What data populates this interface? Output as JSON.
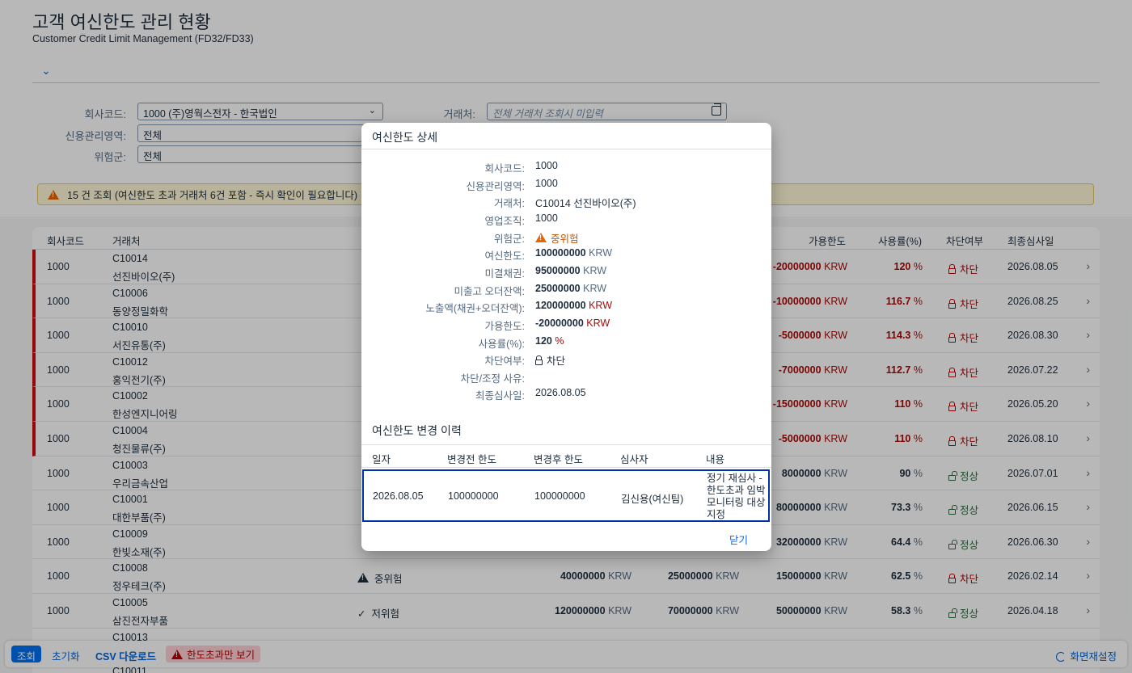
{
  "page": {
    "title": "고객 여신한도 관리 현황",
    "subtitle": "Customer Credit Limit Management (FD32/FD33)"
  },
  "filters": {
    "company_label": "회사코드:",
    "company_value": "1000 (주)영웍스전자 - 한국법인",
    "credit_area_label": "신용관리영역:",
    "credit_area_value": "전체",
    "risk_label": "위험군:",
    "risk_value": "전체",
    "customer_label": "거래처:",
    "customer_placeholder": "전체 거래처 조회시 미입력"
  },
  "message": "15 건 조회 (여신한도 초과 거래처 6건 포함 - 즉시 확인이 필요합니다)",
  "table": {
    "headers": {
      "company": "회사코드",
      "customer": "거래처",
      "available": "가용한도",
      "rate": "사용률(%)",
      "blocked": "차단여부",
      "last_review": "최종심사일"
    },
    "unit": "KRW",
    "pct": "%",
    "rows": [
      {
        "company": "1000",
        "id": "C10014",
        "name": "선진바이오(주)",
        "available": "-20000000",
        "rate": "120",
        "blocked": "차단",
        "date": "2026.08.05"
      },
      {
        "company": "1000",
        "id": "C10006",
        "name": "동양정밀화학",
        "available": "-10000000",
        "rate": "116.7",
        "blocked": "차단",
        "date": "2026.08.25"
      },
      {
        "company": "1000",
        "id": "C10010",
        "name": "서진유통(주)",
        "available": "-5000000",
        "rate": "114.3",
        "blocked": "차단",
        "date": "2026.08.30"
      },
      {
        "company": "1000",
        "id": "C10012",
        "name": "홍익전기(주)",
        "available": "-7000000",
        "rate": "112.7",
        "blocked": "차단",
        "date": "2026.07.22"
      },
      {
        "company": "1000",
        "id": "C10002",
        "name": "한성엔지니어링",
        "available": "-15000000",
        "rate": "110",
        "blocked": "차단",
        "date": "2026.05.20"
      },
      {
        "company": "1000",
        "id": "C10004",
        "name": "청진물류(주)",
        "available": "-5000000",
        "rate": "110",
        "blocked": "차단",
        "date": "2026.08.10"
      },
      {
        "company": "1000",
        "id": "C10003",
        "name": "우리금속산업",
        "available": "8000000",
        "rate": "90",
        "blocked": "정상",
        "date": "2026.07.01"
      },
      {
        "company": "1000",
        "id": "C10001",
        "name": "대한부품(주)",
        "available": "80000000",
        "rate": "73.3",
        "blocked": "정상",
        "date": "2026.06.15"
      },
      {
        "company": "1000",
        "id": "C10009",
        "name": "한빛소재(주)",
        "available": "32000000",
        "rate": "64.4",
        "blocked": "정상",
        "date": "2026.06.30"
      },
      {
        "company": "1000",
        "id": "C10008",
        "name": "정우테크(주)",
        "risk": "중위험",
        "limit": "40000000",
        "receivable": "25000000",
        "available": "15000000",
        "rate": "62.5",
        "blocked": "차단",
        "date": "2026.02.14"
      },
      {
        "company": "1000",
        "id": "C10005",
        "name": "삼진전자부품",
        "risk": "저위험",
        "limit": "120000000",
        "receivable": "70000000",
        "available": "50000000",
        "rate": "58.3",
        "blocked": "정상",
        "date": "2026.04.18"
      },
      {
        "company": "",
        "id": "C10013",
        "name": "",
        "available": "",
        "rate": "",
        "blocked": "",
        "date": ""
      },
      {
        "company": "",
        "id": "C10011",
        "name": "",
        "available": "",
        "rate": "",
        "blocked": "",
        "date": ""
      }
    ]
  },
  "footer": {
    "search": "조회",
    "reset": "초기화",
    "csv": "CSV 다운로드",
    "over_only": "한도초과만 보기",
    "layout": "화면재설정"
  },
  "dialog": {
    "title": "여신한도 상세",
    "fields": [
      {
        "label": "회사코드:",
        "value": "1000"
      },
      {
        "label": "신용관리영역:",
        "value": "1000"
      },
      {
        "label": "거래처:",
        "value": "C10014 선진바이오(주)"
      },
      {
        "label": "영업조직:",
        "value": "1000"
      },
      {
        "label": "위험군:",
        "value": "중위험"
      },
      {
        "label": "여신한도:",
        "value": "100000000"
      },
      {
        "label": "미결채권:",
        "value": "95000000"
      },
      {
        "label": "미출고 오더잔액:",
        "value": "25000000"
      },
      {
        "label": "노출액(채권+오더잔액):",
        "value": "120000000"
      },
      {
        "label": "가용한도:",
        "value": "-20000000"
      },
      {
        "label": "사용률(%):",
        "value": "120"
      },
      {
        "label": "차단여부:",
        "value": "차단"
      },
      {
        "label": "차단/조정 사유:",
        "value": ""
      },
      {
        "label": "최종심사일:",
        "value": "2026.08.05"
      }
    ],
    "unit": "KRW",
    "pct": "%",
    "history_title": "여신한도 변경 이력",
    "history_headers": {
      "date": "일자",
      "before": "변경전 한도",
      "after": "변경후 한도",
      "reviewer": "심사자",
      "content": "내용"
    },
    "history_row": {
      "date": "2026.08.05",
      "before": "100000000",
      "after": "100000000",
      "reviewer": "김신용(여신팀)",
      "content": "정기 재심사 - 한도초과 임박 모니터링 대상 지정"
    },
    "close": "닫기"
  }
}
